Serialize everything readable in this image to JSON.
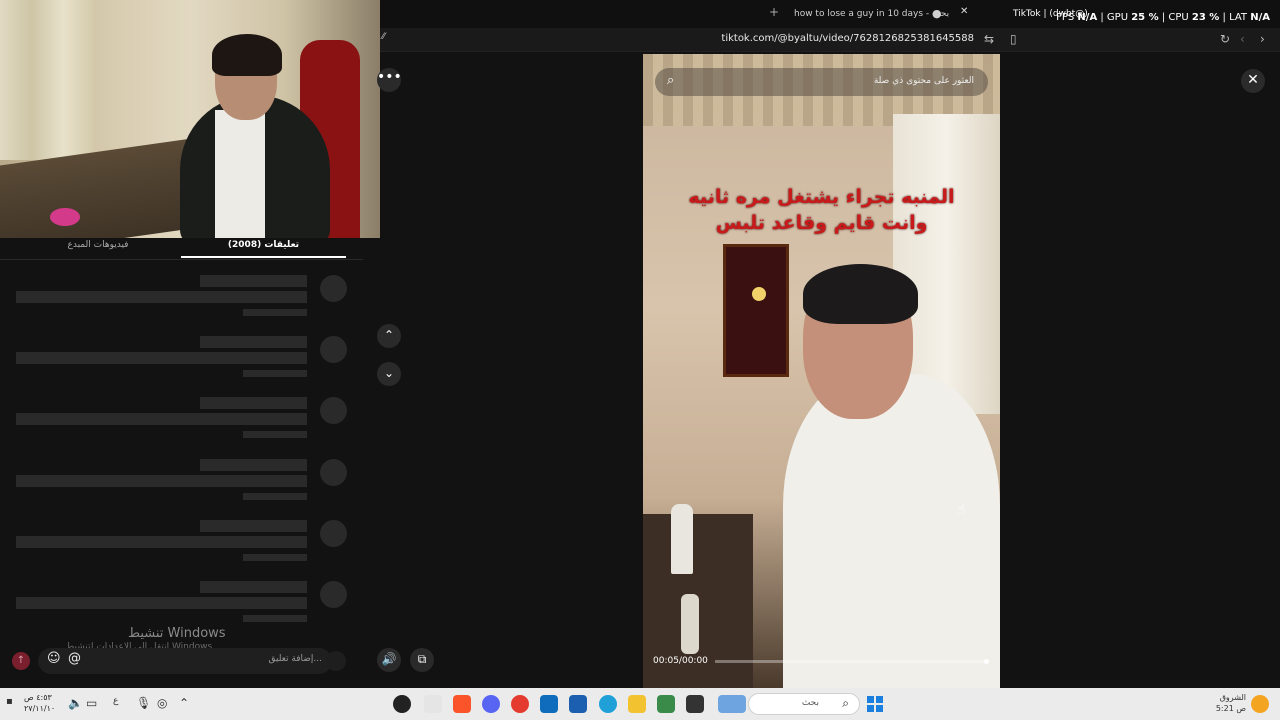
{
  "browser": {
    "tabs": [
      {
        "label": "TikTok | (dwbt@) لاشتُخاء لحساب امامی..."
      },
      {
        "label": "how to lose a guy in 10 days - بحث"
      }
    ],
    "url": "tiktok.com/@byaltu/video/7628126825381645588",
    "stats": {
      "fps_label": "FPS",
      "fps": "N/A",
      "gpu_label": "GPU",
      "gpu": "25 %",
      "cpu_label": "CPU",
      "cpu": "23 %",
      "lat_label": "LAT",
      "lat": "N/A"
    }
  },
  "comments_panel": {
    "tab_comments": "(2008) تعليقات",
    "tab_videos": "فيديوهات المبدع",
    "input_placeholder": "إضافة تعليق...",
    "emoji_icon": "smile-icon",
    "mention_icon": "@"
  },
  "watermark": {
    "line1": "تنشيط Windows",
    "line2": "انتقل إلى الإعدادات لتنشيط Windows"
  },
  "video": {
    "search_placeholder": "العثور على محتوى ذي صلة",
    "caption_line1": "المنبه تجراء يشتغل مره ثانيه",
    "caption_line2": "وانت قايم وقاعد تلبس",
    "time": "00:05/00:00",
    "progress": 1.0
  },
  "taskbar": {
    "search_placeholder": "بحث",
    "clock_time": "٤:٥٣ ص",
    "clock_date": "٢٧/١١/١٠",
    "weather_label": "الشروق",
    "weather_time": "5:21 ص"
  },
  "colors": {
    "caption": "#c81a1a",
    "accent": "#7a1f2e"
  }
}
